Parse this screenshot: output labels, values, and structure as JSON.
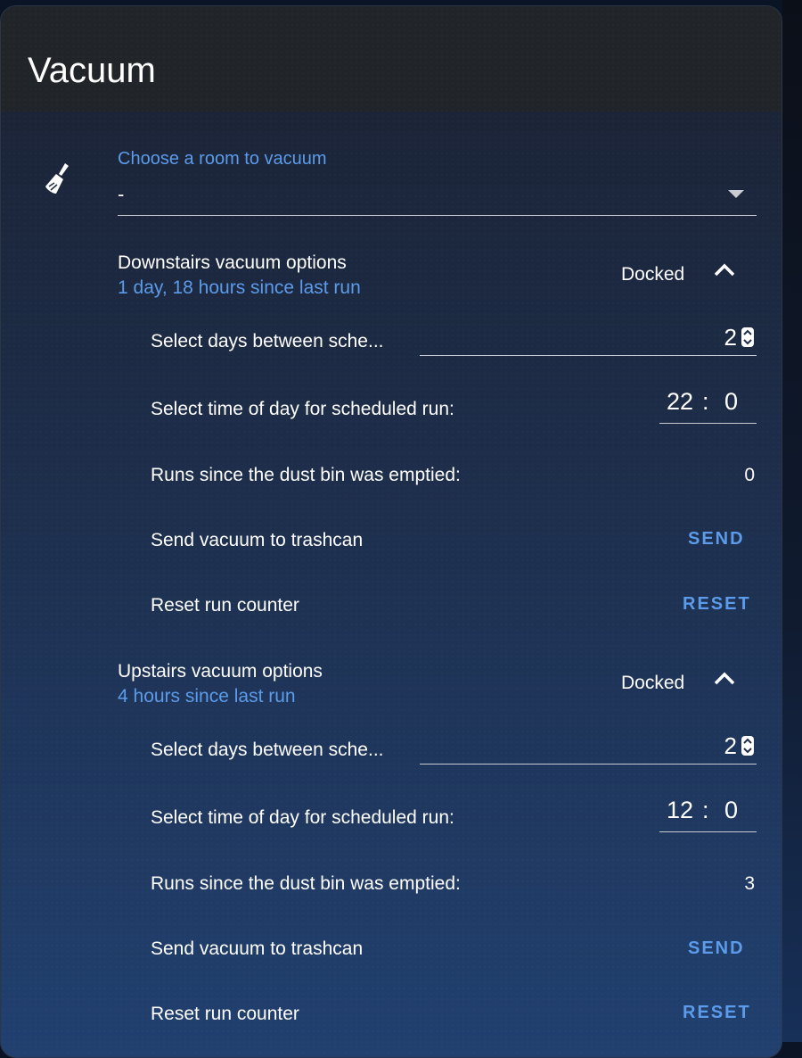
{
  "card": {
    "title": "Vacuum"
  },
  "room_select": {
    "label": "Choose a room to vacuum",
    "value": "-"
  },
  "sections": [
    {
      "name": "Downstairs vacuum options",
      "since_last_run": "1 day, 18 hours since last run",
      "state": "Docked",
      "days_label": "Select days between sche...",
      "days_value": "2",
      "time_label": "Select time of day for scheduled run:",
      "time_hour": "22",
      "time_sep": ":",
      "time_minute": "0",
      "runs_label": "Runs since the dust bin was emptied:",
      "runs_value": "0",
      "trash_label": "Send vacuum to trashcan",
      "trash_button": "SEND",
      "reset_label": "Reset run counter",
      "reset_button": "RESET"
    },
    {
      "name": "Upstairs vacuum options",
      "since_last_run": "4 hours since last run",
      "state": "Docked",
      "days_label": "Select days between sche...",
      "days_value": "2",
      "time_label": "Select time of day for scheduled run:",
      "time_hour": "12",
      "time_sep": ":",
      "time_minute": "0",
      "runs_label": "Runs since the dust bin was emptied:",
      "runs_value": "3",
      "trash_label": "Send vacuum to trashcan",
      "trash_button": "SEND",
      "reset_label": "Reset run counter",
      "reset_button": "RESET"
    }
  ],
  "icons": {
    "room_icon": "broom-icon",
    "expand_icon": "chevron-up-icon",
    "spinner_icon": "spinner-icon"
  },
  "colors": {
    "accent": "#5b9bea",
    "header_bg": "#212429",
    "text": "#ffffff"
  }
}
